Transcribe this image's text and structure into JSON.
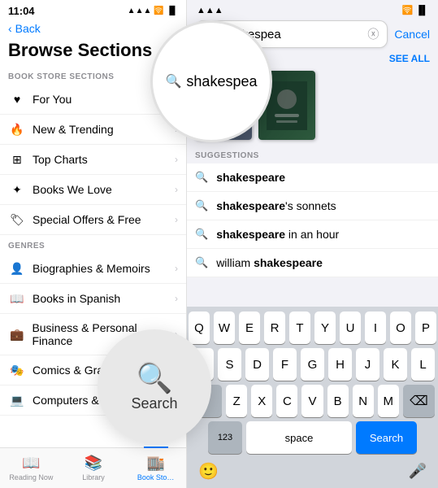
{
  "status": {
    "time": "11:04",
    "signal": "●●●",
    "wifi": "WiFi",
    "battery": "🔋"
  },
  "left": {
    "back_label": "Back",
    "title": "Browse Sections",
    "sections_header": "BOOK STORE SECTIONS",
    "genres_header": "GENRES",
    "items": [
      {
        "icon": "♥",
        "label": "For You"
      },
      {
        "icon": "🔥",
        "label": "New & Trending"
      },
      {
        "icon": "⊞",
        "label": "Top Charts"
      },
      {
        "icon": "✦",
        "label": "Books We Love"
      },
      {
        "icon": "🏷",
        "label": "Special Offers & Free"
      }
    ],
    "genres": [
      {
        "icon": "👤",
        "label": "Biographies & Memoirs"
      },
      {
        "icon": "📖",
        "label": "Books in Spanish"
      },
      {
        "icon": "💼",
        "label": "Business & Personal Finance"
      },
      {
        "icon": "🎭",
        "label": "Comics & Graphic Novels"
      },
      {
        "icon": "💻",
        "label": "Computers & Internet"
      }
    ]
  },
  "tabs": [
    {
      "label": "Reading Now",
      "icon": "📖",
      "active": false
    },
    {
      "label": "Library",
      "icon": "📚",
      "active": false
    },
    {
      "label": "Book Sto…",
      "icon": "🏬",
      "active": true
    }
  ],
  "right": {
    "search_value": "shakespea",
    "cancel_label": "Cancel",
    "see_all_label": "SEE ALL",
    "suggestions_header": "SUGGESTIONS",
    "suggestions": [
      {
        "text": "shakespeare",
        "bold": "shakespeare",
        "rest": ""
      },
      {
        "text": "shakespeare's sonnets",
        "bold": "shakespeare",
        "rest": "'s sonnets"
      },
      {
        "text": "shakespeare in an hour",
        "bold": "shakespeare",
        "rest": " in an hour"
      },
      {
        "text": "william shakespeare",
        "bold": "shakespeare",
        "pre": "william "
      }
    ],
    "keyboard": {
      "rows": [
        [
          "Q",
          "W",
          "E",
          "R",
          "T",
          "Y",
          "U",
          "I",
          "O",
          "P"
        ],
        [
          "A",
          "S",
          "D",
          "F",
          "G",
          "H",
          "J",
          "K",
          "L"
        ],
        [
          "Z",
          "X",
          "C",
          "V",
          "B",
          "N",
          "M"
        ]
      ],
      "num_label": "123",
      "space_label": "space",
      "search_label": "Search",
      "delete_char": "⌫",
      "shift_char": "⇧"
    }
  },
  "magnifier": {
    "search_icon": "🔍",
    "text": "shakespea"
  },
  "circle_search": {
    "icon": "🔍",
    "label": "Search"
  }
}
